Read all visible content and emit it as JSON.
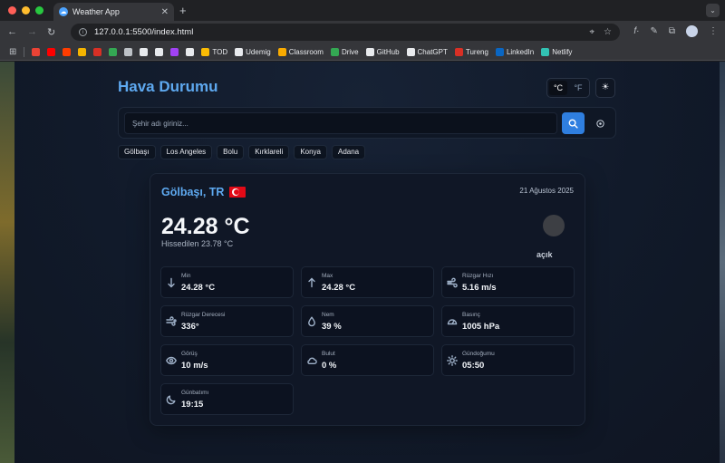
{
  "browser": {
    "tab_title": "Weather App",
    "url": "127.0.0.1:5500/index.html",
    "bookmarks": [
      {
        "label": "",
        "icon": "gmail-icon",
        "color": "#ea4335"
      },
      {
        "label": "",
        "icon": "youtube-icon",
        "color": "#ff0000"
      },
      {
        "label": "",
        "icon": "music-icon",
        "color": "#ff3d00"
      },
      {
        "label": "",
        "icon": "bookmark-icon",
        "color": "#f4b400"
      },
      {
        "label": "",
        "icon": "bookmark-icon",
        "color": "#d93025"
      },
      {
        "label": "",
        "icon": "bookmark-icon",
        "color": "#34a853"
      },
      {
        "label": "",
        "icon": "globe-icon",
        "color": "#bdc1c6"
      },
      {
        "label": "",
        "icon": "bookmark-icon",
        "color": "#e8eaed"
      },
      {
        "label": "",
        "icon": "bookmark-icon",
        "color": "#e8eaed"
      },
      {
        "label": "",
        "icon": "bookmark-icon",
        "color": "#a142f4"
      },
      {
        "label": "",
        "icon": "bookmark-icon",
        "color": "#e8eaed"
      },
      {
        "label": "TOD",
        "icon": "tod-icon",
        "color": "#fbbc04"
      },
      {
        "label": "Udemig",
        "icon": "udemig-icon",
        "color": "#e8eaed"
      },
      {
        "label": "Classroom",
        "icon": "classroom-icon",
        "color": "#f9ab00"
      },
      {
        "label": "Drive",
        "icon": "drive-icon",
        "color": "#34a853"
      },
      {
        "label": "GitHub",
        "icon": "github-icon",
        "color": "#e8eaed"
      },
      {
        "label": "ChatGPT",
        "icon": "chatgpt-icon",
        "color": "#e8eaed"
      },
      {
        "label": "Tureng",
        "icon": "tureng-icon",
        "color": "#d93025"
      },
      {
        "label": "LinkedIn",
        "icon": "linkedin-icon",
        "color": "#0a66c2"
      },
      {
        "label": "Netlify",
        "icon": "netlify-icon",
        "color": "#32c3b4"
      }
    ]
  },
  "app": {
    "title": "Hava Durumu",
    "unit_celsius": "°C",
    "unit_fahrenheit": "°F",
    "theme_icon": "sun-icon",
    "search_placeholder": "Şehir adı giriniz...",
    "quick_cities": [
      "Gölbaşı",
      "Los Angeles",
      "Bolu",
      "Kırklareli",
      "Konya",
      "Adana"
    ]
  },
  "weather": {
    "city": "Gölbaşı, TR",
    "date": "21 Ağustos 2025",
    "temperature": "24.28 °C",
    "feels_like": "Hissedilen 23.78 °C",
    "condition": "açık",
    "stats": [
      {
        "label": "Min",
        "value": "24.28 °C",
        "icon": "arrow-down-icon"
      },
      {
        "label": "Max",
        "value": "24.28 °C",
        "icon": "arrow-up-icon"
      },
      {
        "label": "Rüzgar Hızı",
        "value": "5.16 m/s",
        "icon": "wind-icon"
      },
      {
        "label": "Rüzgar Derecesi",
        "value": "336°",
        "icon": "wind-direction-icon"
      },
      {
        "label": "Nem",
        "value": "39 %",
        "icon": "droplet-icon"
      },
      {
        "label": "Basınç",
        "value": "1005 hPa",
        "icon": "gauge-icon"
      },
      {
        "label": "Görüş",
        "value": "10 m/s",
        "icon": "eye-icon"
      },
      {
        "label": "Bulut",
        "value": "0 %",
        "icon": "cloud-icon"
      },
      {
        "label": "Gündoğumu",
        "value": "05:50",
        "icon": "sunrise-icon"
      },
      {
        "label": "Günbatımı",
        "value": "19:15",
        "icon": "moon-icon"
      }
    ]
  },
  "colors": {
    "accent": "#5ea9f0",
    "search_button": "#2f7fe0",
    "card_bg": "#101726"
  }
}
